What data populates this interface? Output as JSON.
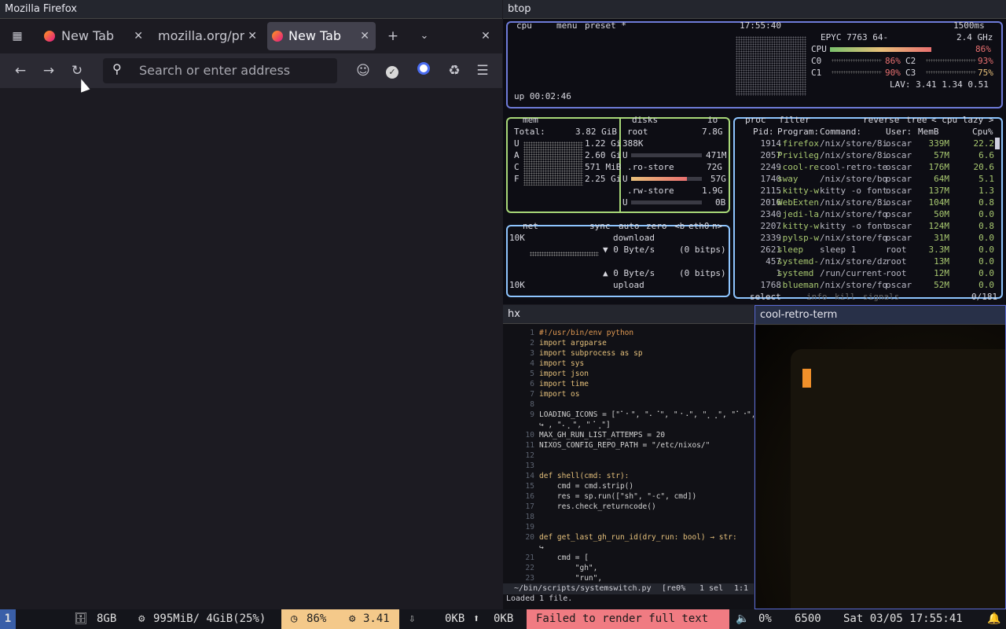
{
  "firefox": {
    "window_title": "Mozilla Firefox",
    "tabs": [
      {
        "label": "New Tab",
        "active": false
      },
      {
        "label": "mozilla.org/pr",
        "active": false
      },
      {
        "label": "New Tab",
        "active": true
      }
    ],
    "url_placeholder": "Search or enter address"
  },
  "btop": {
    "window_title": "btop",
    "header": {
      "cpu": "cpu",
      "menu": "menu",
      "preset": "preset *",
      "clock": "17:55:40",
      "interval": "1500ms",
      "uptime": "up 00:02:46"
    },
    "cpu": {
      "model": "EPYC 7763 64-",
      "freq": "2.4 GHz",
      "total_label": "CPU",
      "total_pct": "86%",
      "total_frac": 0.86,
      "cores": [
        {
          "name": "C0",
          "pct": "86%"
        },
        {
          "name": "C2",
          "pct": "93%"
        },
        {
          "name": "C1",
          "pct": "90%"
        },
        {
          "name": "C3",
          "pct": "75%"
        }
      ],
      "lav": "LAV: 3.41 1.34 0.51"
    },
    "mem": {
      "title": "mem",
      "total_label": "Total:",
      "total": "3.82 GiB",
      "rows": [
        {
          "k": "U",
          "v": "1.22 Gi"
        },
        {
          "k": "A",
          "v": "2.60 Gi"
        },
        {
          "k": "C",
          "v": "571 MiB"
        },
        {
          "k": "F",
          "v": "2.25 Gi"
        }
      ]
    },
    "disks": {
      "title": "disks",
      "io": "io",
      "items": [
        {
          "name": "root",
          "size": "7.8G",
          "used": "388K",
          "u": "U",
          "uval": "471M",
          "frac": 0.0
        },
        {
          "name": ".ro-store",
          "size": "72G",
          "u": "U",
          "uval": "57G",
          "frac": 0.79
        },
        {
          "name": ".rw-store",
          "size": "1.9G",
          "u": "U",
          "uval": "0B",
          "frac": 0.0
        }
      ]
    },
    "net": {
      "title": "net",
      "sync": "sync",
      "auto": "auto",
      "zero": "zero",
      "b": "<b",
      "iface": "eth0",
      "n": "n>",
      "top": "10K",
      "bottom": "10K",
      "download": "download",
      "dl_rate": "▼ 0 Byte/s",
      "dl_bits": "(0 bitps)",
      "ul_rate": "▲ 0 Byte/s",
      "ul_bits": "(0 bitps)",
      "upload": "upload"
    },
    "proc": {
      "title": "proc",
      "filter": "filter",
      "reverse": "reverse",
      "tree": "tree",
      "sort": "< cpu lazy >",
      "headers": [
        "Pid:",
        "Program:",
        "Command:",
        "User:",
        "MemB",
        "Cpu%"
      ],
      "rows": [
        [
          "1914",
          ".firefox",
          "/nix/store/8i",
          "oscar",
          "339M",
          "22.2"
        ],
        [
          "2057",
          "Privileg",
          "/nix/store/8i",
          "oscar",
          "57M",
          "6.6"
        ],
        [
          "2249",
          ".cool-re",
          "cool-retro-te",
          "oscar",
          "176M",
          "20.6"
        ],
        [
          "1740",
          "sway",
          "/nix/store/bq",
          "oscar",
          "64M",
          "5.1"
        ],
        [
          "2115",
          ".kitty-w",
          "kitty -o font",
          "oscar",
          "137M",
          "1.3"
        ],
        [
          "2016",
          "WebExten",
          "/nix/store/8i",
          "oscar",
          "104M",
          "0.8"
        ],
        [
          "2340",
          ".jedi-la",
          "/nix/store/fq",
          "oscar",
          "50M",
          "0.0"
        ],
        [
          "2207",
          ".kitty-w",
          "kitty -o font",
          "oscar",
          "124M",
          "0.8"
        ],
        [
          "2339",
          ".pylsp-w",
          "/nix/store/fq",
          "oscar",
          "31M",
          "0.0"
        ],
        [
          "2621",
          "sleep",
          "sleep 1",
          "root",
          "3.3M",
          "0.0"
        ],
        [
          "457",
          "systemd-",
          "/nix/store/dz",
          "root",
          "13M",
          "0.0"
        ],
        [
          "1",
          "systemd",
          "/run/current-",
          "root",
          "12M",
          "0.0"
        ],
        [
          "1768",
          ".blueman",
          "/nix/store/fq",
          "oscar",
          "52M",
          "0.0"
        ]
      ],
      "footer_select": "select",
      "footer_info": "info",
      "footer_kill": "kill",
      "footer_signals": "signals",
      "count": "0/181"
    }
  },
  "helix": {
    "window_title": "hx",
    "lines": [
      [
        "1",
        "#!/usr/bin/env python"
      ],
      [
        "2",
        "import argparse"
      ],
      [
        "3",
        "import subprocess as sp"
      ],
      [
        "4",
        "import sys"
      ],
      [
        "5",
        "import json"
      ],
      [
        "6",
        "import time"
      ],
      [
        "7",
        "import os"
      ],
      [
        "8",
        ""
      ],
      [
        "9",
        "LOADING_ICONS = [\"⠁⠂\", \"⠄⠈\", \"⠐⠠\", \"⡀⢀\", \"⠁⠐\", \"⠂\""
      ],
      [
        "",
        "↪ , \"⠄⡀\", \"⠈⢀\"]"
      ],
      [
        "10",
        "MAX_GH_RUN_LIST_ATTEMPS = 20"
      ],
      [
        "11",
        "NIXOS_CONFIG_REPO_PATH = \"/etc/nixos/\""
      ],
      [
        "12",
        ""
      ],
      [
        "13",
        ""
      ],
      [
        "14",
        "def shell(cmd: str):"
      ],
      [
        "15",
        "    cmd = cmd.strip()"
      ],
      [
        "16",
        "    res = sp.run([\"sh\", \"-c\", cmd])"
      ],
      [
        "17",
        "    res.check_returncode()"
      ],
      [
        "18",
        ""
      ],
      [
        "19",
        ""
      ],
      [
        "20",
        "def get_last_gh_run_id(dry_run: bool) → str:"
      ],
      [
        "",
        "↪"
      ],
      [
        "21",
        "    cmd = ["
      ],
      [
        "22",
        "        \"gh\","
      ],
      [
        "23",
        "        \"run\","
      ]
    ],
    "status_path": "~/bin/scripts/systemswitch.py",
    "status_flags": "[re0%",
    "status_sel": "1 sel",
    "status_pos": "1:1",
    "message": "Loaded 1 file."
  },
  "crt": {
    "window_title": "cool-retro-term"
  },
  "statusbar": {
    "workspace": "1",
    "disk": "8GB",
    "mem": "995MiB/ 4GiB(25%)",
    "cpu": "86%",
    "load": "3.41",
    "net_down": "0KB",
    "net_up": "0KB",
    "error": "Failed to render full text",
    "volume": "0%",
    "temp": "6500",
    "datetime": "Sat 03/05 17:55:41"
  },
  "colors": {
    "cpu_bar": "#e8a07a",
    "accent": "#8ec5ff",
    "error_bg": "#f07b82",
    "load_bg": "#f4c98a"
  }
}
